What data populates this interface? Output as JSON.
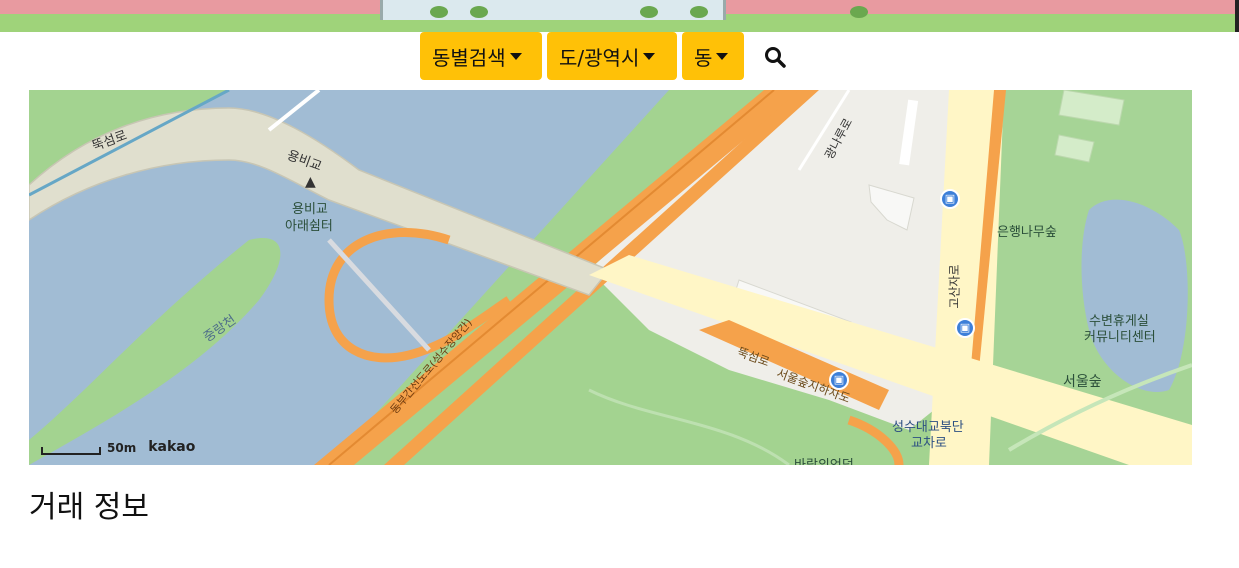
{
  "toolbar": {
    "menu1_label": "동별검색",
    "menu2_label": "도/광역시",
    "menu3_label": "동"
  },
  "map": {
    "labels": {
      "ttukseom_ro_top": "뚝섬로",
      "yongbigyo_bridge": "용비교",
      "yongbigyo_shelter_line1": "용비교",
      "yongbigyo_shelter_line2": "아래쉼터",
      "jungnangcheon": "중랑천",
      "gwangnaru_ro": "광나루로",
      "gosanja_ro": "고산자로",
      "ginkgo_forest": "은행나무숲",
      "rest_area_line1": "수변휴게실",
      "rest_area_line2": "커뮤니티센터",
      "seoul_forest": "서울숲",
      "expressway": "동부간선도로(성수장앙간)",
      "ttukseom_ro_bottom": "뚝섬로",
      "seoul_forest_underpass": "서울숲지하차도",
      "seongsu_intersection_line1": "성수대교북단",
      "seongsu_intersection_line2": "교차로",
      "bottom_cut_label": "바람의언덕"
    },
    "scale_text": "50m",
    "brand": "kakao"
  },
  "section": {
    "title": "거래 정보"
  }
}
